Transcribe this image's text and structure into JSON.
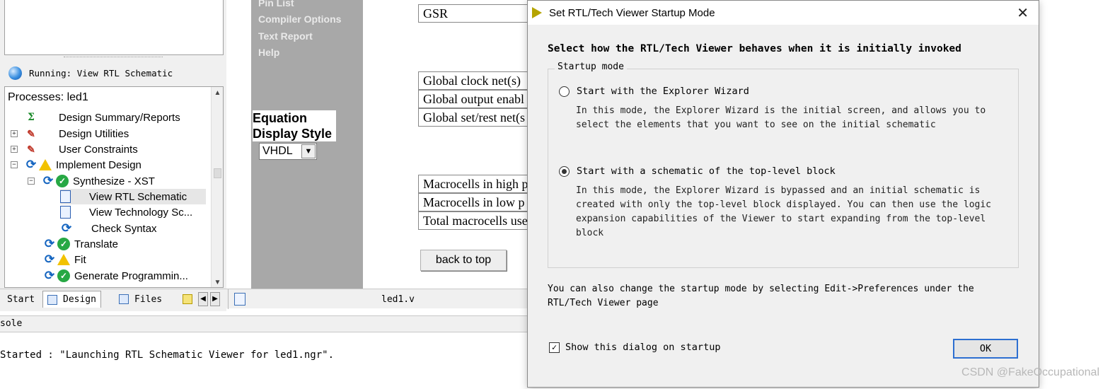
{
  "left_panel": {
    "running_status": "Running: View RTL Schematic",
    "processes_title": "Processes: led1",
    "tree": [
      {
        "label": "Design Summary/Reports",
        "icon": "sigma-icon"
      },
      {
        "label": "Design Utilities",
        "icon": "tool-icon"
      },
      {
        "label": "User Constraints",
        "icon": "tool-icon"
      },
      {
        "label": "Implement Design",
        "icon": "warning-icon"
      },
      {
        "label": "Synthesize - XST",
        "icon": "check-icon"
      },
      {
        "label": "View RTL Schematic",
        "icon": "schematic-icon"
      },
      {
        "label": "View Technology Sc...",
        "icon": "schematic-icon"
      },
      {
        "label": "Check Syntax",
        "icon": "sync-icon"
      },
      {
        "label": "Translate",
        "icon": "check-icon"
      },
      {
        "label": "Fit",
        "icon": "warning-icon"
      },
      {
        "label": "Generate Programmin...",
        "icon": "check-icon"
      }
    ]
  },
  "tabs": {
    "start": "Start",
    "design": "Design",
    "files": "Files",
    "open_file": "led1.v"
  },
  "console": {
    "header": "sole",
    "line": "Started : \"Launching RTL Schematic Viewer for led1.ngr\"."
  },
  "report": {
    "nav_links": [
      "Pin List",
      "Compiler Options",
      "Text Report",
      "Help"
    ],
    "equation_label_1": "Equation",
    "equation_label_2": "Display Style",
    "equation_value": "VHDL",
    "gsr": "GSR",
    "global_rows": [
      "Global clock net(s)",
      "Global output enabl",
      "Global set/rest net(s"
    ],
    "macro_rows": [
      "Macrocells in high p",
      "Macrocells in low p",
      "Total macrocells use"
    ],
    "back_to_top": "back to top"
  },
  "dialog": {
    "title": "Set RTL/Tech Viewer Startup Mode",
    "heading": "Select how the RTL/Tech Viewer behaves when it is initially invoked",
    "group_label": "Startup mode",
    "option1_label": "Start with the Explorer Wizard",
    "option1_desc": "In this mode, the Explorer Wizard is the initial screen, and allows you to select the elements that you want to see on the initial schematic",
    "option2_label": "Start with a schematic of the top-level block",
    "option2_desc": "In this mode, the Explorer Wizard is bypassed and an initial schematic is created with only the top-level block displayed. You can then use the logic expansion capabilities of the Viewer to start expanding from the top-level block",
    "selected_option": 2,
    "note": "You can also change the startup mode by selecting Edit->Preferences under the RTL/Tech Viewer page",
    "checkbox_label": "Show this dialog on startup",
    "checkbox_checked": true,
    "ok_label": "OK"
  },
  "watermark": "CSDN @FakeOccupational"
}
